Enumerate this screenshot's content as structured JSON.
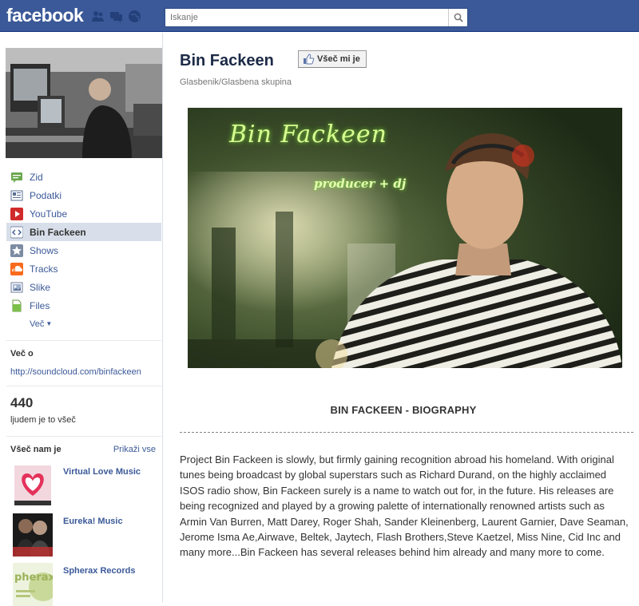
{
  "header": {
    "logo": "facebook",
    "search_placeholder": "Iskanje",
    "jewels": [
      "friends-icon",
      "messages-icon",
      "notifications-icon"
    ]
  },
  "sidebar": {
    "nav": [
      {
        "label": "Zid",
        "icon": "wall-icon"
      },
      {
        "label": "Podatki",
        "icon": "info-icon"
      },
      {
        "label": "YouTube",
        "icon": "youtube-icon"
      },
      {
        "label": "Bin Fackeen",
        "icon": "fbml-icon",
        "active": true
      },
      {
        "label": "Shows",
        "icon": "star-icon"
      },
      {
        "label": "Tracks",
        "icon": "soundcloud-icon"
      },
      {
        "label": "Slike",
        "icon": "photos-icon"
      },
      {
        "label": "Files",
        "icon": "files-icon"
      }
    ],
    "more_label": "Več",
    "about": {
      "heading": "Več o",
      "link": "http://soundcloud.com/binfackeen"
    },
    "likes": {
      "count": "440",
      "text": "ljudem je to všeč"
    },
    "liked_pages": {
      "heading": "Všeč nam je",
      "show_all": "Prikaži vse",
      "items": [
        {
          "name": "Virtual Love Music"
        },
        {
          "name": "Eureka! Music"
        },
        {
          "name": "Spherax Records"
        }
      ]
    }
  },
  "main": {
    "title": "Bin Fackeen",
    "like_button": "Všeč mi je",
    "category": "Glasbenik/Glasbena skupina",
    "banner": {
      "title": "Bin Fackeen",
      "subtitle": "producer + dj"
    },
    "bio_heading": "BIN FACKEEN - BIOGRAPHY",
    "bio_text": "Project Bin Fackeen is slowly, but firmly gaining recognition abroad his homeland. With original tunes being broadcast by global superstars such as Richard Durand, on the highly acclaimed ISOS radio show, Bin Fackeen surely is a name to watch out for, in the future. His releases are being recognized and played by a growing palette of internationally renowned artists such as Armin Van Burren, Matt Darey, Roger Shah, Sander Kleinenberg, Laurent Garnier, Dave Seaman, Jerome Isma Ae,Airwave, Beltek, Jaytech, Flash Brothers,Steve Kaetzel, Miss Nine, Cid Inc and many more...Bin Fackeen has several releases behind him already and many more to come."
  },
  "colors": {
    "brand": "#3b5998",
    "active_bg": "#d8dfea",
    "link": "#3b5998"
  }
}
